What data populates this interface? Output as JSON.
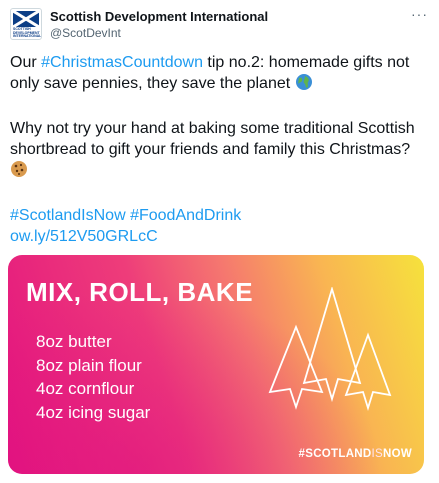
{
  "account": {
    "display_name": "Scottish Development International",
    "handle": "@ScotDevInt",
    "avatar_lettering": "SCOTTISH DEVELOPMENT INTERNATIONAL"
  },
  "tweet": {
    "line1_prefix": "Our ",
    "hashtag1": "#ChristmasCountdown",
    "line1_rest": " tip no.2: homemade gifts not only save pennies, they save the planet",
    "globe_emoji": "globe-icon",
    "para2": "Why not try your hand at baking some traditional Scottish shortbread to gift your friends and family this Christmas?",
    "cookie_emoji": "cookie-icon",
    "hashtag2": "#ScotlandIsNow",
    "hashtag3": "#FoodAndDrink",
    "link": "ow.ly/512V50GRLcC"
  },
  "card": {
    "title": "MIX, ROLL, BAKE",
    "ingredients": [
      "8oz butter",
      "8oz plain flour",
      "4oz cornflour",
      "4oz icing sugar"
    ],
    "hashtag_a": "#SCOTLAND",
    "hashtag_b": "IS",
    "hashtag_c": "NOW"
  },
  "colors": {
    "link": "#1d9bf0",
    "text": "#0f1419",
    "muted": "#536471",
    "gradient_start": "#e3127f",
    "gradient_end": "#f6e23c"
  }
}
